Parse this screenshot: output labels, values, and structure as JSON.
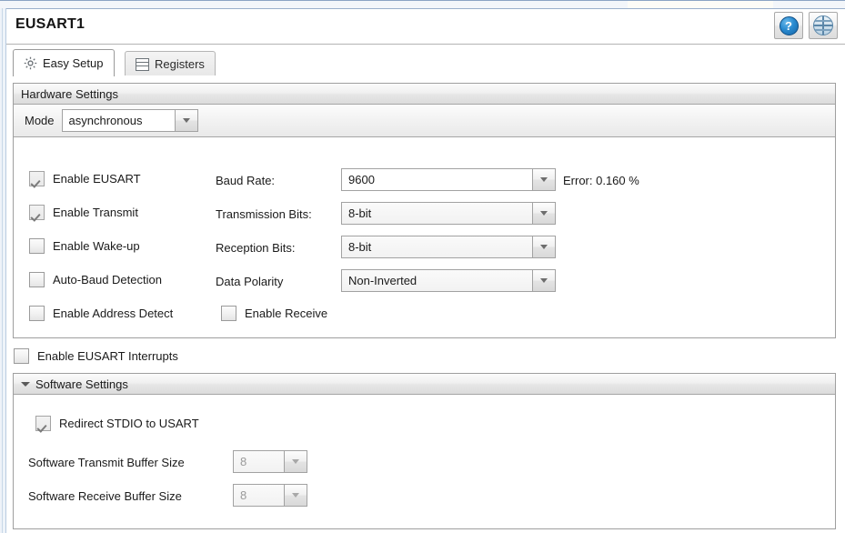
{
  "window": {
    "panel_title": "EUSART1",
    "help_button_label": "?",
    "help_icon": "help-circle-icon",
    "globe_icon": "globe-icon"
  },
  "tabs": [
    {
      "label": "Easy Setup",
      "icon": "gear-icon",
      "active": true
    },
    {
      "label": "Registers",
      "icon": "registers-icon",
      "active": false
    }
  ],
  "hardware_settings": {
    "header": "Hardware Settings",
    "mode": {
      "label": "Mode",
      "value": "asynchronous"
    },
    "checkboxes": [
      {
        "label": "Enable EUSART",
        "checked": true,
        "disabled": true
      },
      {
        "label": "Enable Transmit",
        "checked": true,
        "disabled": true
      },
      {
        "label": "Enable Wake-up",
        "checked": false,
        "disabled": false
      },
      {
        "label": "Auto-Baud Detection",
        "checked": false,
        "disabled": false
      },
      {
        "label": "Enable Address Detect",
        "checked": false,
        "disabled": false
      }
    ],
    "fields": [
      {
        "label": "Baud Rate:",
        "value": "9600",
        "style": "white"
      },
      {
        "label": "Transmission Bits:",
        "value": "8-bit",
        "style": "gray"
      },
      {
        "label": "Reception Bits:",
        "value": "8-bit",
        "style": "gray"
      },
      {
        "label": "Data Polarity",
        "value": "Non-Inverted",
        "style": "gray"
      }
    ],
    "error_text": "Error: 0.160 %",
    "enable_receive": {
      "label": "Enable Receive",
      "checked": false
    }
  },
  "interrupts": {
    "label": "Enable EUSART Interrupts",
    "checked": false
  },
  "software_settings": {
    "header": "Software Settings",
    "expanded": true,
    "redirect_stdio": {
      "label": "Redirect STDIO to USART",
      "checked": true,
      "disabled": true
    },
    "buffers": [
      {
        "label": "Software Transmit Buffer Size",
        "value": "8",
        "disabled": true
      },
      {
        "label": "Software Receive Buffer Size",
        "value": "8",
        "disabled": true
      }
    ]
  }
}
